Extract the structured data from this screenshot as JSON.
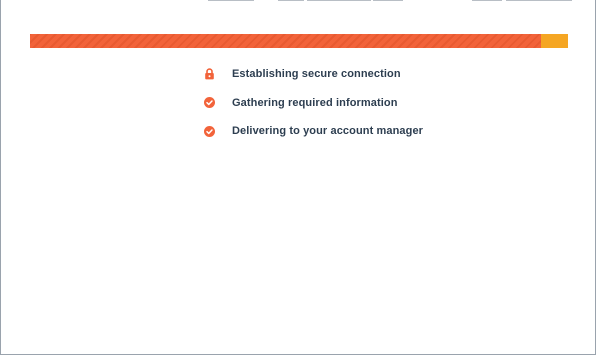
{
  "progress": {
    "value": 0.95,
    "fill_color": "#f2633a",
    "track_color": "#f5a623"
  },
  "steps": [
    {
      "label": "Establishing secure connection",
      "icon": "lock-icon",
      "status": "in-progress"
    },
    {
      "label": "Gathering required information",
      "icon": "check-circle-icon",
      "status": "done"
    },
    {
      "label": "Delivering to your account manager",
      "icon": "check-circle-icon",
      "status": "done"
    }
  ],
  "colors": {
    "accent": "#f2633a",
    "text": "#2d3e50"
  }
}
